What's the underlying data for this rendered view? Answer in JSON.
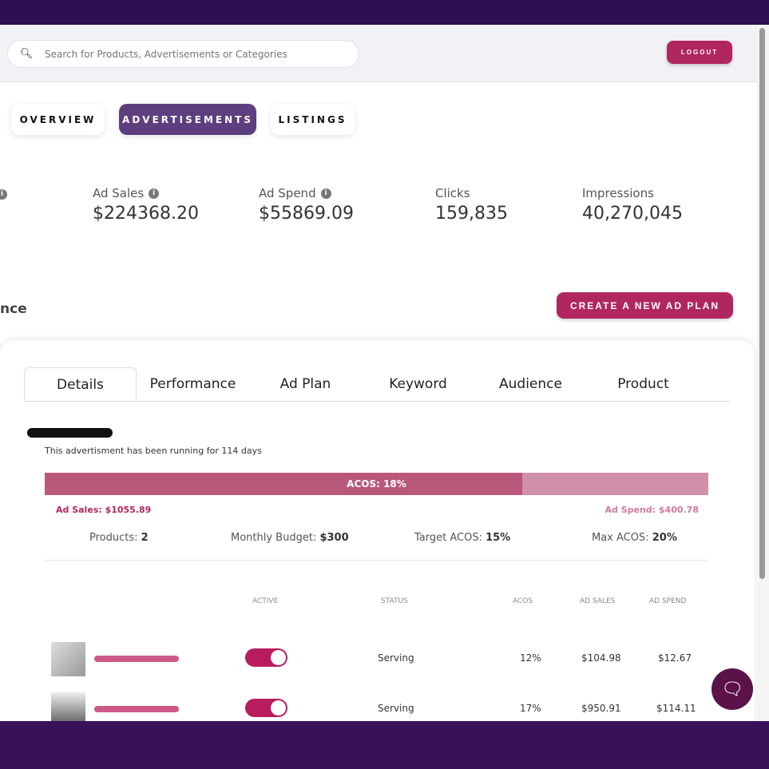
{
  "header": {
    "search_placeholder": "Search for Products, Advertisements or Categories",
    "logout": "LOGOUT"
  },
  "nav": [
    "OVERVIEW",
    "ADVERTISEMENTS",
    "LISTINGS"
  ],
  "stats": [
    {
      "label": "Ad Sales",
      "value": "$224368.20"
    },
    {
      "label": "Ad Spend",
      "value": "$55869.09"
    },
    {
      "label": "Clicks",
      "value": "159,835"
    },
    {
      "label": "Impressions",
      "value": "40,270,045"
    }
  ],
  "section_title": "nce",
  "create_button": "CREATE A NEW AD PLAN",
  "tabs": [
    "Details",
    "Performance",
    "Ad Plan",
    "Keyword",
    "Audience",
    "Product"
  ],
  "details": {
    "running": "This advertisment has been running for 114 days",
    "acos_label": "ACOS:  18%",
    "acos_fraction": 0.72,
    "ad_sales": "Ad Sales: $1055.89",
    "ad_spend": "Ad Spend: $400.78",
    "meta": [
      {
        "label": "Products: ",
        "value": "2"
      },
      {
        "label": "Monthly Budget: ",
        "value": "$300"
      },
      {
        "label": "Target ACOS: ",
        "value": "15%"
      },
      {
        "label": "Max ACOS: ",
        "value": "20%"
      }
    ]
  },
  "table": {
    "headers": [
      "ACTIVE",
      "STATUS",
      "ACOS",
      "AD SALES",
      "AD SPEND"
    ],
    "rows": [
      {
        "status": "Serving",
        "acos": "12%",
        "sales": "$104.98",
        "spend": "$12.67"
      },
      {
        "status": "Serving",
        "acos": "17%",
        "sales": "$950.91",
        "spend": "$114.11"
      }
    ]
  }
}
